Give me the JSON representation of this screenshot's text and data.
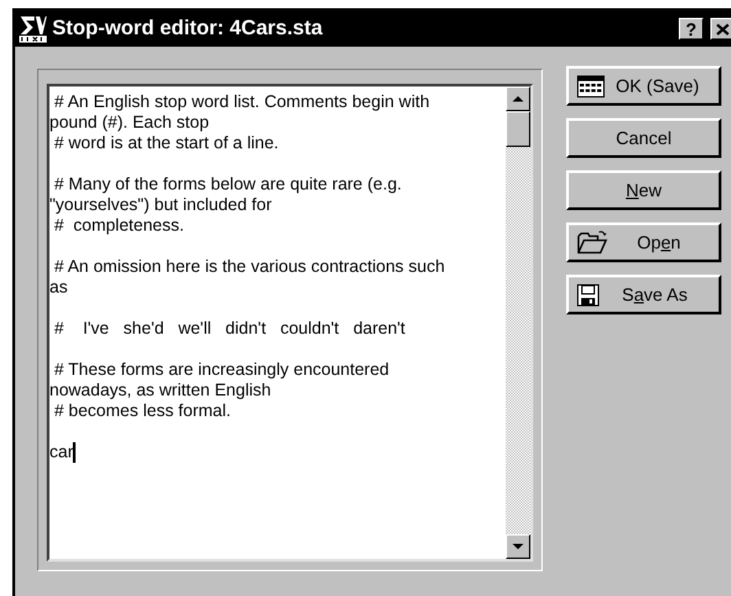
{
  "window": {
    "title": "Stop-word editor: 4Cars.sta",
    "title_buttons": [
      "?"
    ]
  },
  "editor": {
    "paragraphs": [
      [
        " # An English stop word list. Comments begin with",
        "pound (#). Each stop",
        " # word is at the start of a line."
      ],
      [
        " # Many of the forms below are quite rare (e.g.",
        "\"yourselves\") but included for",
        " #  completeness."
      ],
      [
        " # An omission here is the various contractions such",
        "as"
      ],
      [
        " #    I've   she'd   we'll   didn't   couldn't   daren't"
      ],
      [
        " # These forms are increasingly encountered",
        "nowadays, as written English",
        " # becomes less formal."
      ],
      [
        "car"
      ]
    ],
    "cursor_visible": true
  },
  "buttons": [
    {
      "kind": "keyboard",
      "before": "OK (Save)"
    },
    {
      "kind": "none",
      "before": "Cancel"
    },
    {
      "kind": "none",
      "mnemonic": "N",
      "after": "ew"
    },
    {
      "kind": "folder",
      "before": "Op",
      "mnemonic": "e",
      "after": "n"
    },
    {
      "kind": "floppy",
      "before": "S",
      "mnemonic": "a",
      "after": "ve As"
    }
  ]
}
